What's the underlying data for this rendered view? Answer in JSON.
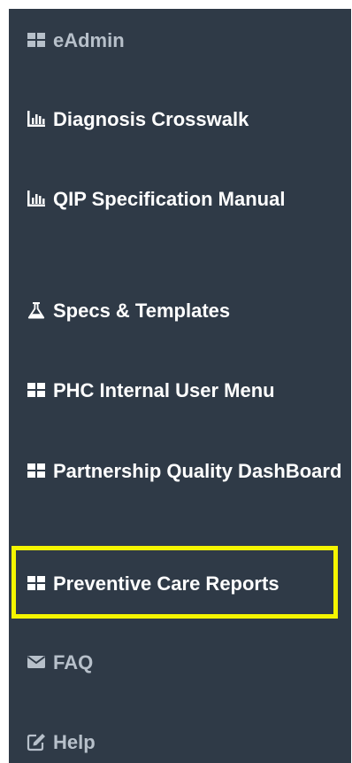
{
  "sidebar": {
    "items": [
      {
        "label": "eAdmin",
        "icon": "grid-icon",
        "muted": true
      },
      {
        "label": "Diagnosis Crosswalk",
        "icon": "bar-chart-icon"
      },
      {
        "label": "QIP Specification Manual",
        "icon": "bar-chart-icon"
      },
      {
        "label": "Specs & Templates",
        "icon": "flask-icon"
      },
      {
        "label": "PHC Internal User Menu",
        "icon": "grid-icon"
      },
      {
        "label": "Partnership Quality DashBoard",
        "icon": "grid-icon"
      },
      {
        "label": "Preventive Care Reports",
        "icon": "grid-icon",
        "highlighted": true
      },
      {
        "label": "FAQ",
        "icon": "envelope-icon",
        "muted": true
      },
      {
        "label": "Help",
        "icon": "edit-icon",
        "muted": true
      }
    ]
  },
  "colors": {
    "sidebar_bg": "#2f3a47",
    "text": "#ffffff",
    "muted_text": "#b7c0ca",
    "highlight": "#f5f500"
  }
}
